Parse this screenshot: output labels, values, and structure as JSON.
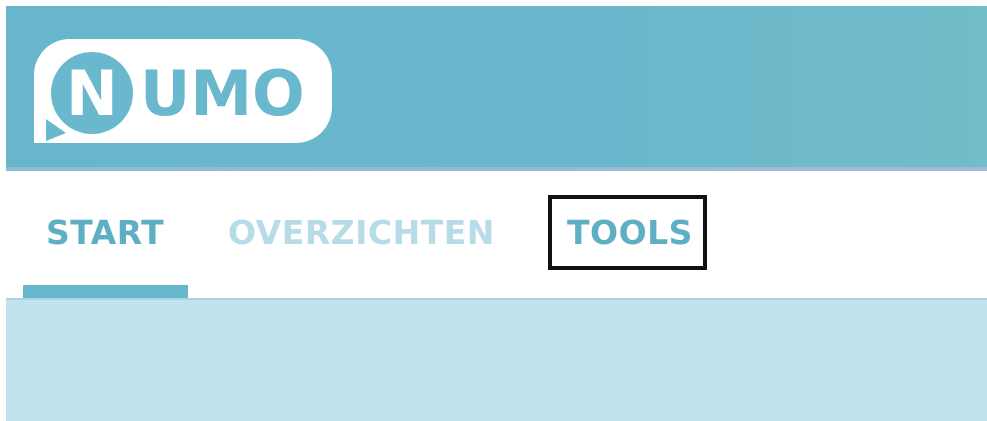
{
  "app": {
    "logo_text": "NUMO"
  },
  "nav": {
    "items": [
      {
        "label": "START",
        "active": true
      },
      {
        "label": "OVERZICHTEN",
        "active": false
      },
      {
        "label": "TOOLS",
        "active": false,
        "highlighted": true
      }
    ]
  },
  "colors": {
    "header": "#6ab8cd",
    "accent": "#5fafc4",
    "inactive_tab": "#b8dce7",
    "content_background": "#c2e2ee",
    "highlight_border": "#111111"
  }
}
